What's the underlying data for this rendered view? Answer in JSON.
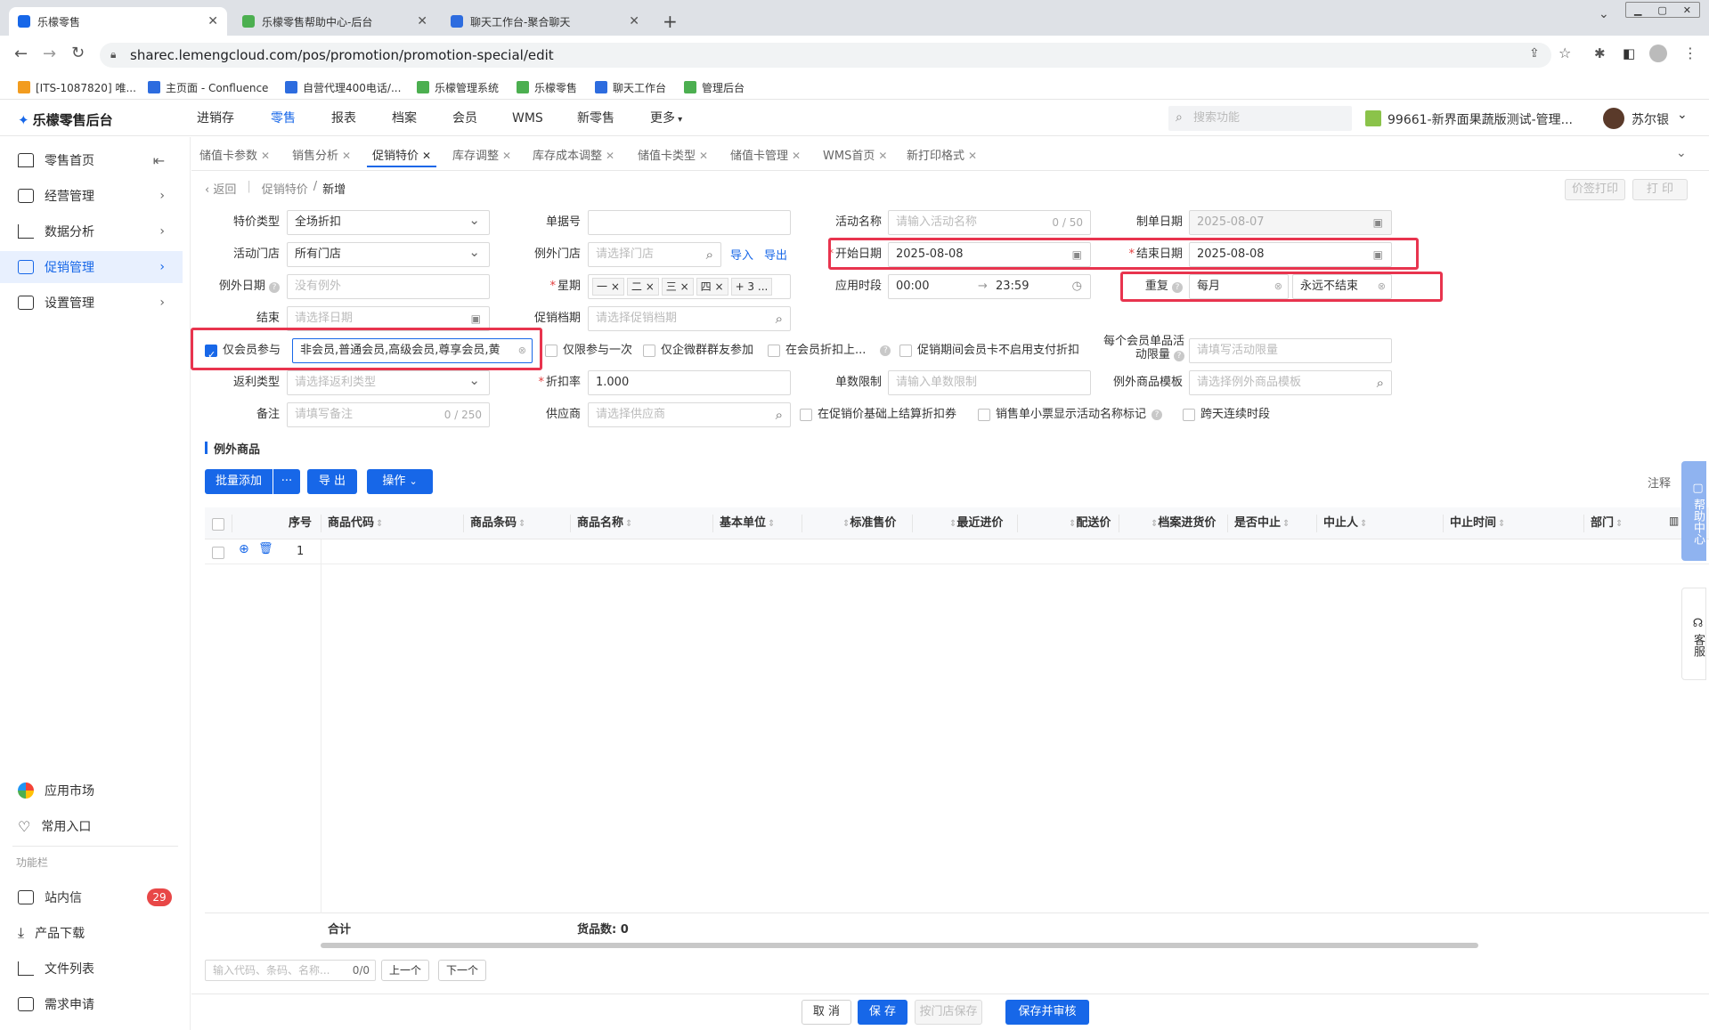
{
  "browser": {
    "tabs": [
      {
        "label": "乐檬零售",
        "active": true
      },
      {
        "label": "乐檬零售帮助中心-后台",
        "active": false
      },
      {
        "label": "聊天工作台-聚合聊天",
        "active": false
      }
    ],
    "url": "sharec.lemengcloud.com/pos/promotion/promotion-special/edit",
    "bookmarks": [
      "[ITS-1087820] 唯...",
      "主页面 - Confluence",
      "自营代理400电话/...",
      "乐檬管理系统",
      "乐檬零售",
      "聊天工作台",
      "管理后台"
    ]
  },
  "app": {
    "logo": "乐檬零售后台",
    "nav": [
      "进销存",
      "零售",
      "报表",
      "档案",
      "会员",
      "WMS",
      "新零售",
      "更多"
    ],
    "nav_active": "零售",
    "search_placeholder": "搜索功能",
    "store": "99661-新界面果蔬版测试-管理...",
    "user": "苏尔银"
  },
  "sidebar": {
    "items": [
      {
        "label": "零售首页",
        "active": false
      },
      {
        "label": "经营管理",
        "active": false
      },
      {
        "label": "数据分析",
        "active": false
      },
      {
        "label": "促销管理",
        "active": true
      },
      {
        "label": "设置管理",
        "active": false
      }
    ],
    "bottom": [
      "应用市场",
      "常用入口"
    ],
    "section_label": "功能栏",
    "func": [
      {
        "label": "站内信",
        "badge": "29"
      },
      {
        "label": "产品下载"
      },
      {
        "label": "文件列表"
      },
      {
        "label": "需求申请"
      }
    ]
  },
  "page_tabs": [
    "储值卡参数",
    "销售分析",
    "促销特价",
    "库存调整",
    "库存成本调整",
    "储值卡类型",
    "储值卡管理",
    "WMS首页",
    "新打印格式"
  ],
  "page_tab_active": "促销特价",
  "breadcrumb": {
    "back": "返回",
    "parent": "促销特价",
    "sep": "/",
    "current": "新增"
  },
  "top_buttons": {
    "price_print": "价签打印",
    "print": "打 印"
  },
  "form": {
    "special_type": {
      "label": "特价类型",
      "value": "全场折扣"
    },
    "bill_no": {
      "label": "单据号",
      "value": ""
    },
    "activity_name": {
      "label": "活动名称",
      "placeholder": "请输入活动名称",
      "count": "0 / 50"
    },
    "create_date": {
      "label": "制单日期",
      "value": "2025-08-07"
    },
    "activity_store": {
      "label": "活动门店",
      "value": "所有门店"
    },
    "except_store": {
      "label": "例外门店",
      "placeholder": "请选择门店",
      "import": "导入",
      "export": "导出"
    },
    "start_date": {
      "label": "开始日期",
      "value": "2025-08-08"
    },
    "end_date": {
      "label": "结束日期",
      "value": "2025-08-08"
    },
    "except_date": {
      "label": "例外日期",
      "placeholder": "没有例外"
    },
    "week": {
      "label": "星期",
      "tags": [
        "一",
        "二",
        "三",
        "四"
      ],
      "more": "+ 3 ..."
    },
    "apply_time": {
      "label": "应用时段",
      "start": "00:00",
      "arrow": "→",
      "end": "23:59"
    },
    "repeat": {
      "label": "重复",
      "value": "每月",
      "end_value": "永远不结束"
    },
    "end": {
      "label": "结束",
      "placeholder": "请选择日期"
    },
    "promo_archive": {
      "label": "促销档期",
      "placeholder": "请选择促销档期"
    },
    "member_only": {
      "label": "仅会员参与",
      "value": "非会员,普通会员,高级会员,尊享会员,黄"
    },
    "checks_row": [
      "仅限参与一次",
      "仅企微群群友参加",
      "在会员折扣上...",
      "促销期间会员卡不启用支付折扣"
    ],
    "member_limit": {
      "label": "每个会员单品活动限量",
      "placeholder": "请填写活动限量"
    },
    "rebate_type": {
      "label": "返利类型",
      "placeholder": "请选择返利类型"
    },
    "discount_rate": {
      "label": "折扣率",
      "value": "1.000"
    },
    "single_limit": {
      "label": "单数限制",
      "placeholder": "请输入单数限制"
    },
    "except_template": {
      "label": "例外商品模板",
      "placeholder": "请选择例外商品模板"
    },
    "remark": {
      "label": "备注",
      "placeholder": "请填写备注",
      "count": "0 / 250"
    },
    "supplier": {
      "label": "供应商",
      "placeholder": "请选择供应商"
    },
    "checks_row2": [
      "在促销价基础上结算折扣券",
      "销售单小票显示活动名称标记",
      "跨天连续时段"
    ]
  },
  "section": {
    "title": "例外商品",
    "buttons": {
      "batch_add": "批量添加",
      "more": "···",
      "export": "导 出",
      "operate": "操作"
    },
    "note": "注释"
  },
  "table": {
    "columns": [
      "序号",
      "商品代码",
      "商品条码",
      "商品名称",
      "基本单位",
      "标准售价",
      "最近进价",
      "配送价",
      "档案进货价",
      "是否中止",
      "中止人",
      "中止时间",
      "部门"
    ],
    "rows": [
      {
        "index": "1"
      }
    ],
    "footer": {
      "total": "合计",
      "count_label": "货品数: 0"
    }
  },
  "pager": {
    "placeholder": "输入代码、条码、名称...",
    "count": "0/0",
    "prev": "上一个",
    "next": "下一个"
  },
  "actions": {
    "cancel": "取 消",
    "save": "保 存",
    "store_save": "按门店保存",
    "save_audit": "保存并审核"
  },
  "right_float": {
    "help": "帮助中心",
    "service": "客服"
  },
  "colors": {
    "primary": "#1767e8",
    "highlight": "#e8344e",
    "badge": "#e84747"
  }
}
